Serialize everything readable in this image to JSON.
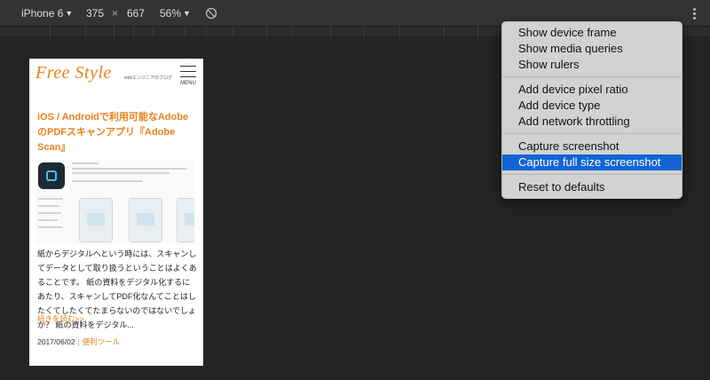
{
  "toolbar": {
    "device": "iPhone 6",
    "width": "375",
    "times": "×",
    "height": "667",
    "zoom": "56%",
    "caret": "▼"
  },
  "device_page": {
    "logo": "Free Style",
    "tagline": "webエンジニアのブログ",
    "menu_label": "MENU",
    "post_title": "iOS / Androidで利用可能なAdobeのPDFスキャンアプリ『Adobe Scan』",
    "excerpt": "紙からデジタルへという時には、スキャンしてデータとして取り扱うということはよくあることです。 紙の資料をデジタル化するにあたり、スキャンしてPDF化なんてことはしたくてしたくてたまらないのではないでしょか？ 紙の資料をデジタル...",
    "read_more": "続きを読む>>",
    "date": "2017/06/02",
    "separator": "|",
    "category": "便利ツール"
  },
  "menu": {
    "items": [
      {
        "label": "Show device frame"
      },
      {
        "label": "Show media queries"
      },
      {
        "label": "Show rulers"
      },
      {
        "label": "Add device pixel ratio"
      },
      {
        "label": "Add device type"
      },
      {
        "label": "Add network throttling"
      },
      {
        "label": "Capture screenshot"
      },
      {
        "label": "Capture full size screenshot",
        "highlighted": true
      },
      {
        "label": "Reset to defaults"
      }
    ]
  },
  "colors": {
    "accent": "#e8811a",
    "highlight": "#1264d6",
    "toolbar_bg": "#333333",
    "canvas_bg": "#242424"
  }
}
